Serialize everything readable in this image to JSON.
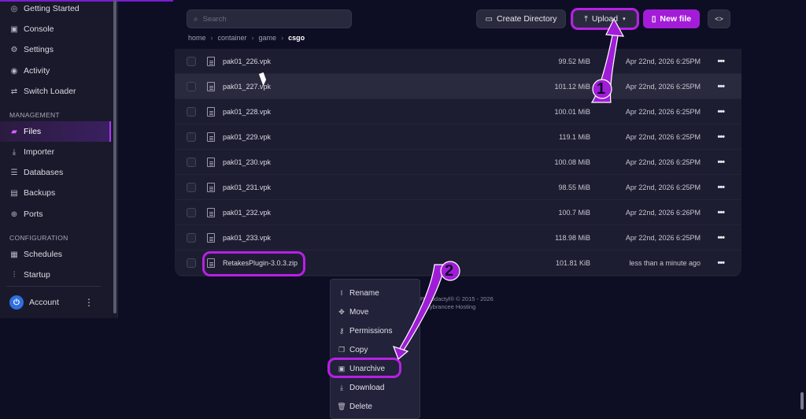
{
  "sidebar": {
    "items_top": [
      {
        "label": "Getting Started",
        "icon": "help-circle-icon"
      },
      {
        "label": "Console",
        "icon": "terminal-icon"
      },
      {
        "label": "Settings",
        "icon": "gear-icon"
      },
      {
        "label": "Activity",
        "icon": "eye-icon"
      },
      {
        "label": "Switch Loader",
        "icon": "switch-icon"
      }
    ],
    "management_label": "MANAGEMENT",
    "items_management": [
      {
        "label": "Files",
        "icon": "folder-icon",
        "active": true
      },
      {
        "label": "Importer",
        "icon": "download-icon"
      },
      {
        "label": "Databases",
        "icon": "database-icon"
      },
      {
        "label": "Backups",
        "icon": "archive-icon"
      },
      {
        "label": "Ports",
        "icon": "globe-icon"
      }
    ],
    "configuration_label": "CONFIGURATION",
    "items_configuration": [
      {
        "label": "Schedules",
        "icon": "calendar-icon"
      },
      {
        "label": "Startup",
        "icon": "sliders-icon"
      }
    ],
    "account_label": "Account"
  },
  "toolbar": {
    "search_placeholder": "Search",
    "create_directory_label": "Create Directory",
    "upload_label": "Upload",
    "new_file_label": "New file",
    "code_toggle_label": "<>"
  },
  "breadcrumb": {
    "parts": [
      "home",
      "container",
      "game"
    ],
    "current": "csgo"
  },
  "files": [
    {
      "name": "pak01_226.vpk",
      "size": "99.52 MiB",
      "modified": "Apr 22nd, 2026 6:25PM"
    },
    {
      "name": "pak01_227.vpk",
      "size": "101.12 MiB",
      "modified": "Apr 22nd, 2026 6:25PM"
    },
    {
      "name": "pak01_228.vpk",
      "size": "100.01 MiB",
      "modified": "Apr 22nd, 2026 6:25PM"
    },
    {
      "name": "pak01_229.vpk",
      "size": "119.1 MiB",
      "modified": "Apr 22nd, 2026 6:25PM"
    },
    {
      "name": "pak01_230.vpk",
      "size": "100.08 MiB",
      "modified": "Apr 22nd, 2026 6:25PM"
    },
    {
      "name": "pak01_231.vpk",
      "size": "98.55 MiB",
      "modified": "Apr 22nd, 2026 6:25PM"
    },
    {
      "name": "pak01_232.vpk",
      "size": "100.7 MiB",
      "modified": "Apr 22nd, 2026 6:26PM"
    },
    {
      "name": "pak01_233.vpk",
      "size": "118.98 MiB",
      "modified": "Apr 22nd, 2026 6:25PM"
    },
    {
      "name": "RetakesPlugin-3.0.3.zip",
      "size": "101.81 KiB",
      "modified": "less than a minute ago"
    }
  ],
  "footer": {
    "line1": "Pterodactyl® © 2015 - 2026",
    "line2": "Lybrancee Hosting"
  },
  "context_menu": [
    {
      "label": "Rename",
      "icon": "text-cursor-icon"
    },
    {
      "label": "Move",
      "icon": "move-icon"
    },
    {
      "label": "Permissions",
      "icon": "key-icon"
    },
    {
      "label": "Copy",
      "icon": "copy-icon"
    },
    {
      "label": "Unarchive",
      "icon": "unarchive-icon"
    },
    {
      "label": "Download",
      "icon": "download-icon"
    },
    {
      "label": "Delete",
      "icon": "trash-icon"
    }
  ],
  "annotations": {
    "step1": "1",
    "step2": "2",
    "highlight_color": "#b91fe6"
  }
}
